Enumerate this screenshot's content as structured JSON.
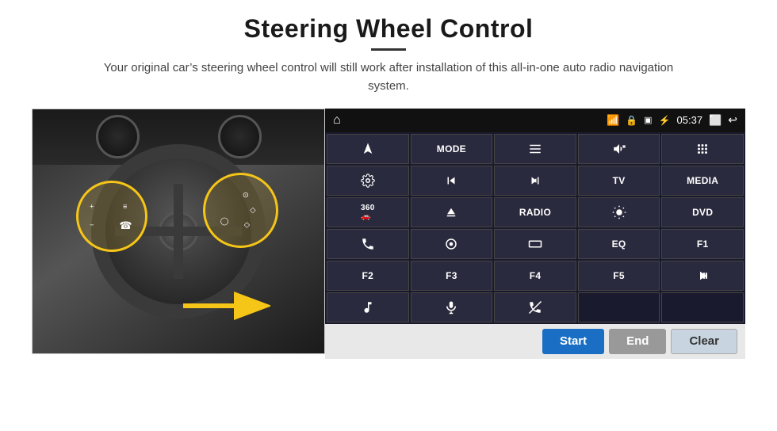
{
  "page": {
    "title": "Steering Wheel Control",
    "subtitle": "Your original car’s steering wheel control will still work after installation of this all-in-one auto radio navigation system.",
    "divider": true
  },
  "header": {
    "home_icon": "home-icon",
    "wifi_icon": "wifi-icon",
    "lock_icon": "lock-icon",
    "sd_icon": "sd-icon",
    "bt_icon": "bluetooth-icon",
    "time": "05:37",
    "screen_icon": "screen-icon",
    "back_icon": "back-icon"
  },
  "panel": {
    "rows": [
      [
        {
          "type": "icon",
          "icon": "nav-icon",
          "label": ""
        },
        {
          "type": "text",
          "label": "MODE"
        },
        {
          "type": "icon",
          "icon": "list-icon",
          "label": ""
        },
        {
          "type": "icon",
          "icon": "mute-icon",
          "label": ""
        },
        {
          "type": "icon",
          "icon": "apps-icon",
          "label": ""
        }
      ],
      [
        {
          "type": "icon",
          "icon": "settings-icon",
          "label": ""
        },
        {
          "type": "icon",
          "icon": "prev-icon",
          "label": ""
        },
        {
          "type": "icon",
          "icon": "next-icon",
          "label": ""
        },
        {
          "type": "text",
          "label": "TV"
        },
        {
          "type": "text",
          "label": "MEDIA"
        }
      ],
      [
        {
          "type": "icon",
          "icon": "cam360-icon",
          "label": ""
        },
        {
          "type": "icon",
          "icon": "eject-icon",
          "label": ""
        },
        {
          "type": "text",
          "label": "RADIO"
        },
        {
          "type": "icon",
          "icon": "brightness-icon",
          "label": ""
        },
        {
          "type": "text",
          "label": "DVD"
        }
      ],
      [
        {
          "type": "icon",
          "icon": "phone-icon",
          "label": ""
        },
        {
          "type": "icon",
          "icon": "navi-icon",
          "label": ""
        },
        {
          "type": "icon",
          "icon": "screen-icon",
          "label": ""
        },
        {
          "type": "text",
          "label": "EQ"
        },
        {
          "type": "text",
          "label": "F1"
        }
      ],
      [
        {
          "type": "text",
          "label": "F2"
        },
        {
          "type": "text",
          "label": "F3"
        },
        {
          "type": "text",
          "label": "F4"
        },
        {
          "type": "text",
          "label": "F5"
        },
        {
          "type": "icon",
          "icon": "playpause-icon",
          "label": ""
        }
      ],
      [
        {
          "type": "icon",
          "icon": "music-icon",
          "label": ""
        },
        {
          "type": "icon",
          "icon": "mic-icon",
          "label": ""
        },
        {
          "type": "icon",
          "icon": "hangup-icon",
          "label": ""
        },
        {
          "type": "empty",
          "label": ""
        },
        {
          "type": "empty",
          "label": ""
        }
      ]
    ]
  },
  "actions": {
    "start_label": "Start",
    "end_label": "End",
    "clear_label": "Clear"
  }
}
